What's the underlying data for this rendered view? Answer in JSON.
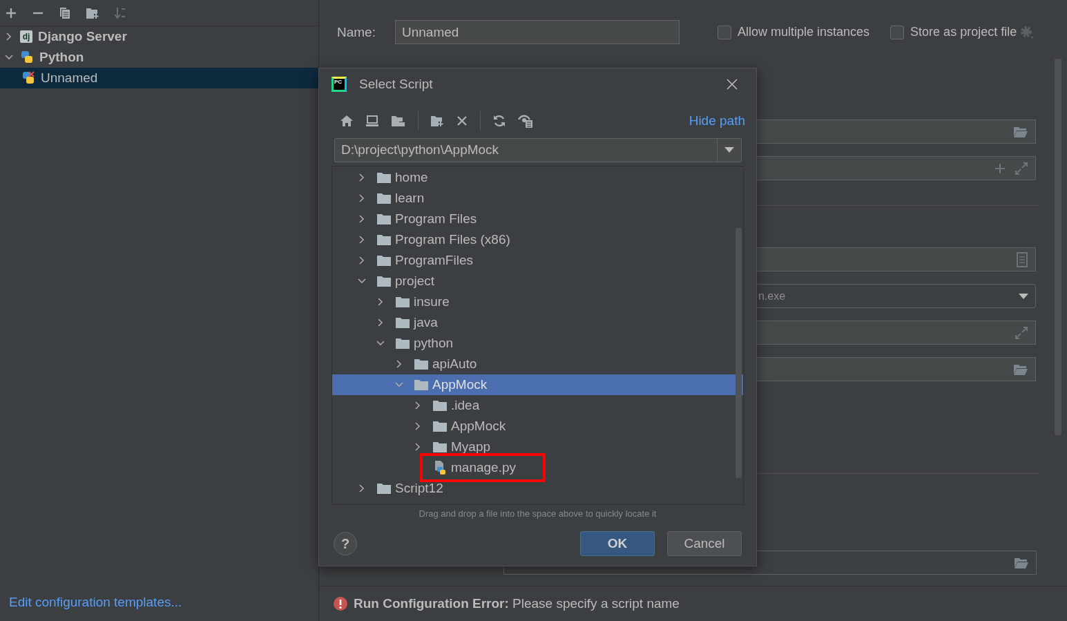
{
  "sidebar": {
    "toolbar": [
      {
        "kind": "add",
        "disabled": false
      },
      {
        "kind": "remove",
        "disabled": false
      },
      {
        "kind": "copy",
        "disabled": false
      },
      {
        "kind": "new-folder",
        "disabled": false
      },
      {
        "kind": "sort",
        "disabled": true
      }
    ],
    "tree": [
      {
        "label": "Django Server",
        "kind": "django",
        "icon_text": "dj",
        "expanded": false,
        "selected": false
      },
      {
        "label": "Python",
        "kind": "python",
        "expanded": true,
        "selected": false,
        "children": [
          {
            "label": "Unnamed",
            "kind": "python-error",
            "selected": true
          }
        ]
      }
    ],
    "templates_link": "Edit configuration templates..."
  },
  "form": {
    "name_label": "Name:",
    "name_value": "Unnamed",
    "checkboxes": [
      {
        "label": "Allow multiple instances",
        "checked": false
      },
      {
        "label": "Store as project file",
        "checked": false
      }
    ],
    "fields": [
      {
        "kind": "browse"
      },
      {
        "kind": "add-expand"
      },
      {
        "kind": "separator"
      },
      {
        "kind": "document"
      },
      {
        "kind": "dropdown",
        "value": "n.exe"
      },
      {
        "kind": "expand"
      },
      {
        "kind": "browse"
      },
      {
        "kind": "separator"
      },
      {
        "kind": "redirect"
      }
    ],
    "error": "**Run Configuration Error:** Please specify a script name"
  },
  "dialog": {
    "logo_text": "PC",
    "title": "Select Script",
    "toolbar": [
      {
        "kind": "home"
      },
      {
        "kind": "desktop"
      },
      {
        "kind": "project"
      },
      {
        "kind": "separator"
      },
      {
        "kind": "new-folder"
      },
      {
        "kind": "delete"
      },
      {
        "kind": "separator"
      },
      {
        "kind": "refresh"
      },
      {
        "kind": "show-hidden"
      }
    ],
    "hide_path": "Hide path",
    "path": "D:\\project\\python\\AppMock",
    "tree": [
      {
        "label": "home",
        "kind": "folder",
        "expanded": false,
        "selected": false
      },
      {
        "label": "learn",
        "kind": "folder",
        "expanded": false,
        "selected": false
      },
      {
        "label": "Program Files",
        "kind": "folder",
        "expanded": false,
        "selected": false
      },
      {
        "label": "Program Files (x86)",
        "kind": "folder",
        "expanded": false,
        "selected": false
      },
      {
        "label": "ProgramFiles",
        "kind": "folder",
        "expanded": false,
        "selected": false
      },
      {
        "label": "project",
        "kind": "folder",
        "expanded": true,
        "selected": false,
        "children": [
          {
            "label": "insure",
            "kind": "folder",
            "expanded": false,
            "selected": false
          },
          {
            "label": "java",
            "kind": "folder",
            "expanded": false,
            "selected": false
          },
          {
            "label": "python",
            "kind": "folder",
            "expanded": true,
            "selected": false,
            "children": [
              {
                "label": "apiAuto",
                "kind": "folder",
                "expanded": false,
                "selected": false
              },
              {
                "label": "AppMock",
                "kind": "folder",
                "expanded": true,
                "selected": true,
                "children": [
                  {
                    "label": ".idea",
                    "kind": "folder",
                    "expanded": false,
                    "selected": false
                  },
                  {
                    "label": "AppMock",
                    "kind": "folder",
                    "expanded": false,
                    "selected": false
                  },
                  {
                    "label": "Myapp",
                    "kind": "folder",
                    "expanded": false,
                    "selected": false
                  },
                  {
                    "label": "manage.py",
                    "kind": "python-file",
                    "selected": false,
                    "annotated": true
                  }
                ]
              }
            ]
          }
        ]
      },
      {
        "label": "Script12",
        "kind": "folder",
        "expanded": false,
        "selected": false
      }
    ],
    "hint": "Drag and drop a file into the space above to quickly locate it",
    "help": "?",
    "buttons": [
      {
        "label": "OK",
        "kind": "primary"
      },
      {
        "label": "Cancel",
        "kind": "secondary"
      }
    ]
  }
}
